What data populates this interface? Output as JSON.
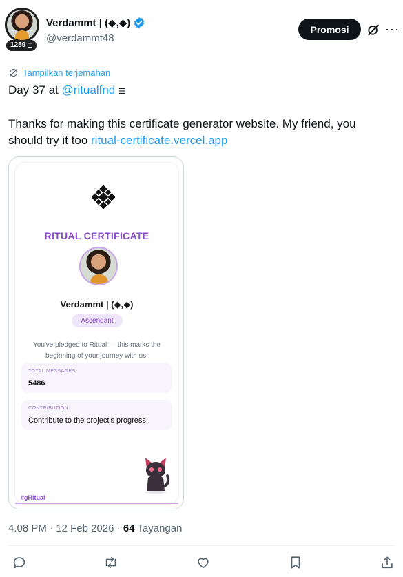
{
  "header": {
    "display_name": "Verdammt | (◆,◆)",
    "handle": "@verdammt48",
    "follower_badge": "1289",
    "promo_button": "Promosi",
    "verified_color": "#1d9bf0"
  },
  "post": {
    "translate_label": "Tampilkan terjemahan",
    "line1_text": "Day 37 at ",
    "line1_mention": "@ritualfnd",
    "line2_text": "Thanks for making this certificate generator website. My friend, you",
    "line3_text": "should try it too ",
    "line3_link": "ritual-certificate.vercel.app"
  },
  "certificate": {
    "title": "RITUAL CERTIFICATE",
    "name": "Verdammt | (◆,◆)",
    "rank": "Ascendant",
    "pledge_text": "You've pledged to Ritual — this marks the beginning of your journey with us.",
    "stats": [
      {
        "label": "TOTAL MESSAGES",
        "value": "5486"
      },
      {
        "label": "CONTRIBUTION",
        "value": "Contribute to the project's progress"
      }
    ],
    "hashtag": "#gRitual",
    "accent_color": "#8a4cc8"
  },
  "meta": {
    "time": "4.08 PM",
    "date": "12 Feb 2026",
    "views": "64",
    "views_label": "Tayangan"
  },
  "actions": {
    "icons": [
      "reply-icon",
      "repost-icon",
      "like-icon",
      "bookmark-icon",
      "share-icon"
    ]
  }
}
